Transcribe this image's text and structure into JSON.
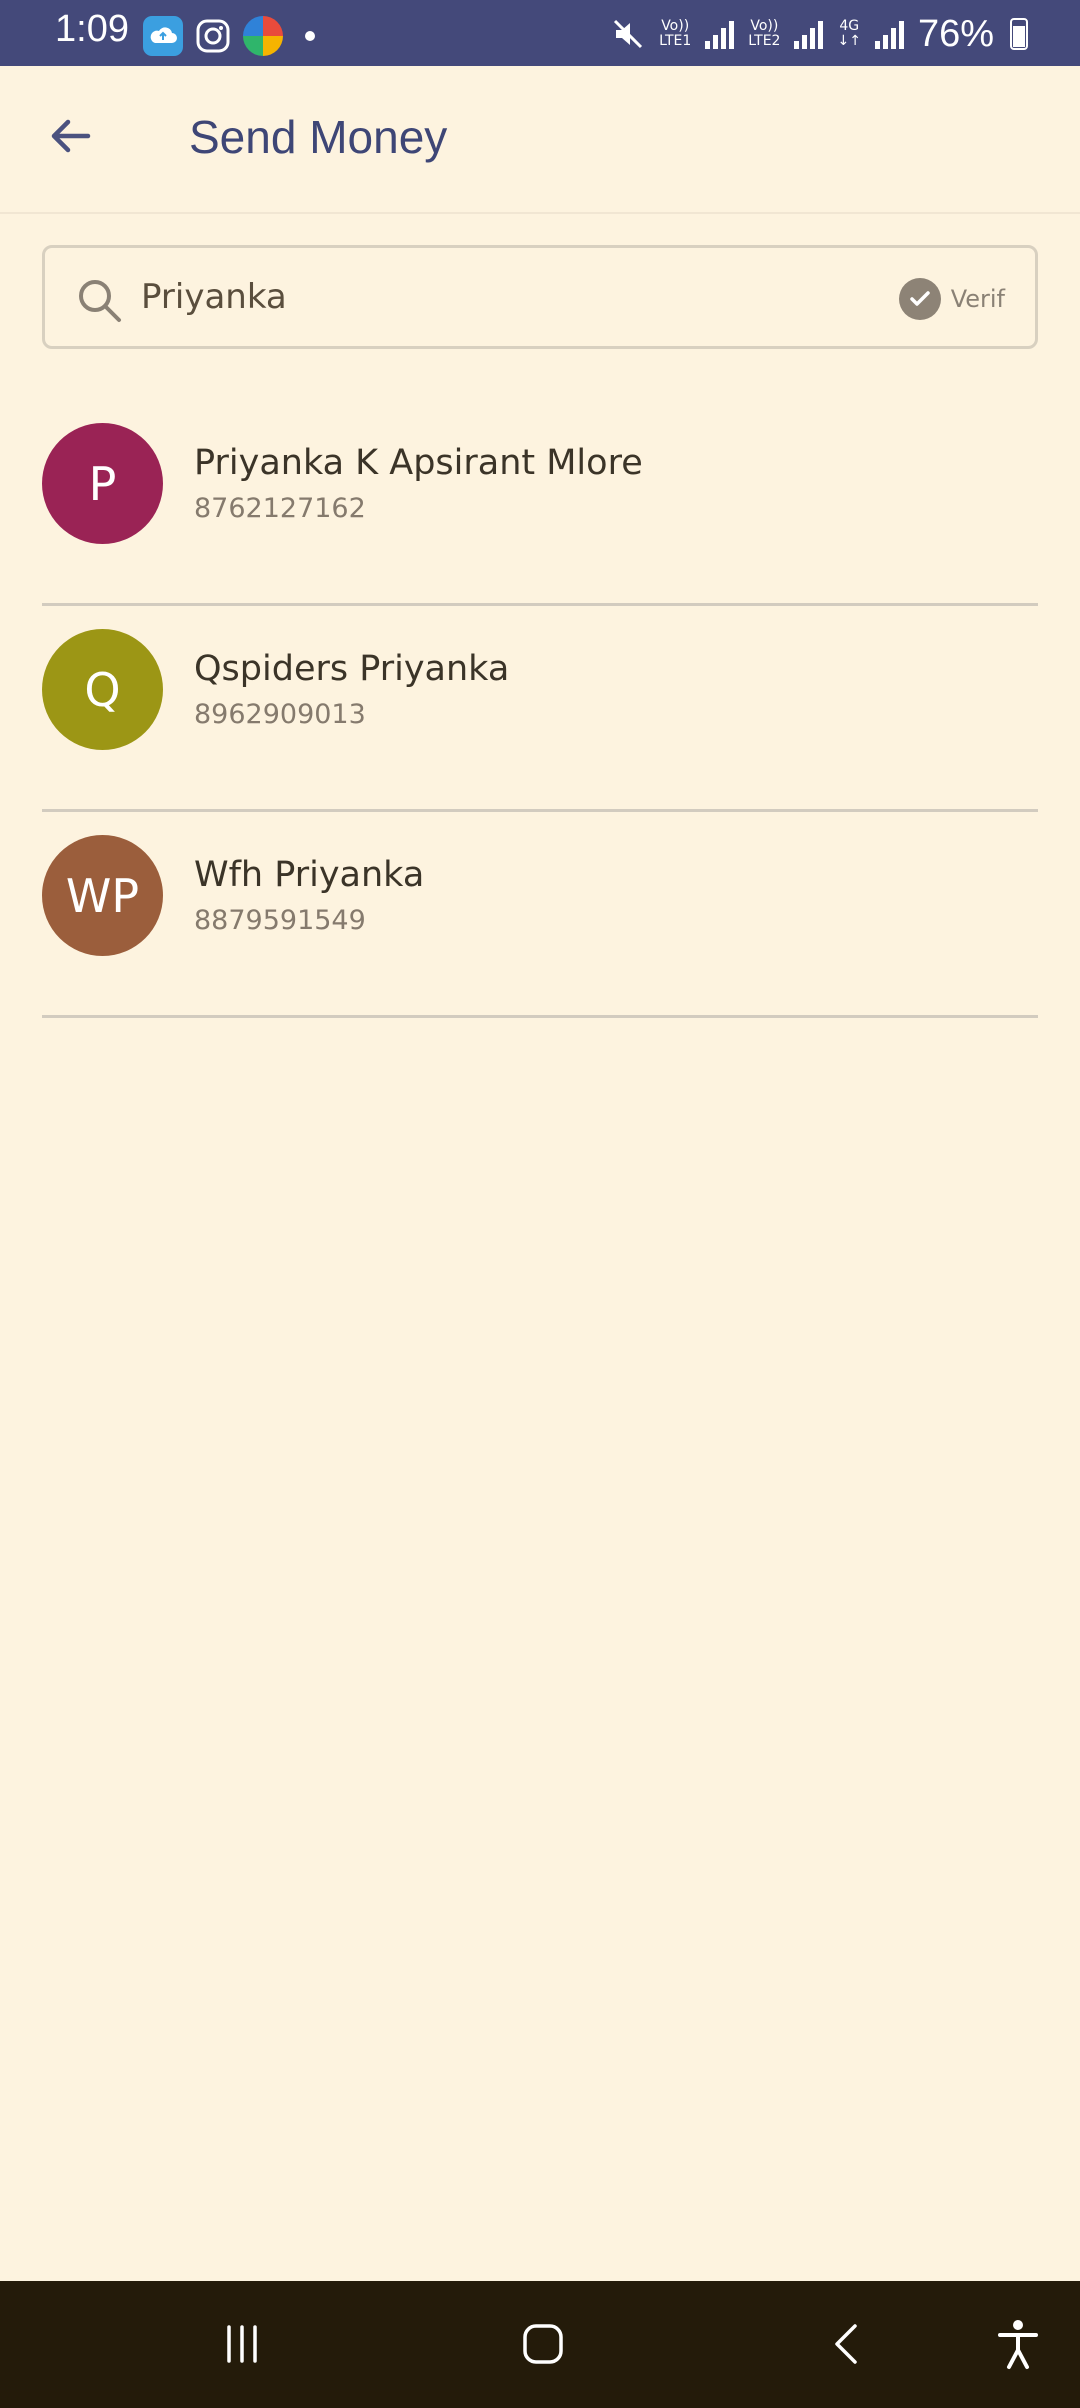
{
  "status_bar": {
    "time": "1:09",
    "sim1_label_top": "Vo))",
    "sim1_label_bottom": "LTE1",
    "sim2_label_top": "Vo))",
    "sim2_label_bottom": "LTE2",
    "network_type": "4G",
    "battery": "76%",
    "icons": [
      "cloud-app-icon",
      "instagram-icon",
      "browser-icon",
      "mute-icon",
      "signal-icon",
      "battery-charging-icon"
    ]
  },
  "header": {
    "title": "Send Money",
    "back_icon": "arrow-left-icon"
  },
  "search": {
    "value": "Priyanka",
    "placeholder": "",
    "verify_label": "Verif"
  },
  "contacts": [
    {
      "initials": "P",
      "name": "Priyanka K Apsirant Mlore",
      "phone": "8762127162",
      "avatar_color": "#9a2355"
    },
    {
      "initials": "Q",
      "name": "Qspiders Priyanka",
      "phone": "8962909013",
      "avatar_color": "#9c9615"
    },
    {
      "initials": "WP",
      "name": "Wfh Priyanka",
      "phone": "8879591549",
      "avatar_color": "#9b5e3c"
    }
  ],
  "nav": {
    "items": [
      "recent-apps-icon",
      "home-icon",
      "back-icon",
      "accessibility-icon"
    ]
  },
  "colors": {
    "status_bar": "#44497a",
    "background": "#fdf3df",
    "title": "#3e4676",
    "nav_bar": "#241b0a"
  }
}
